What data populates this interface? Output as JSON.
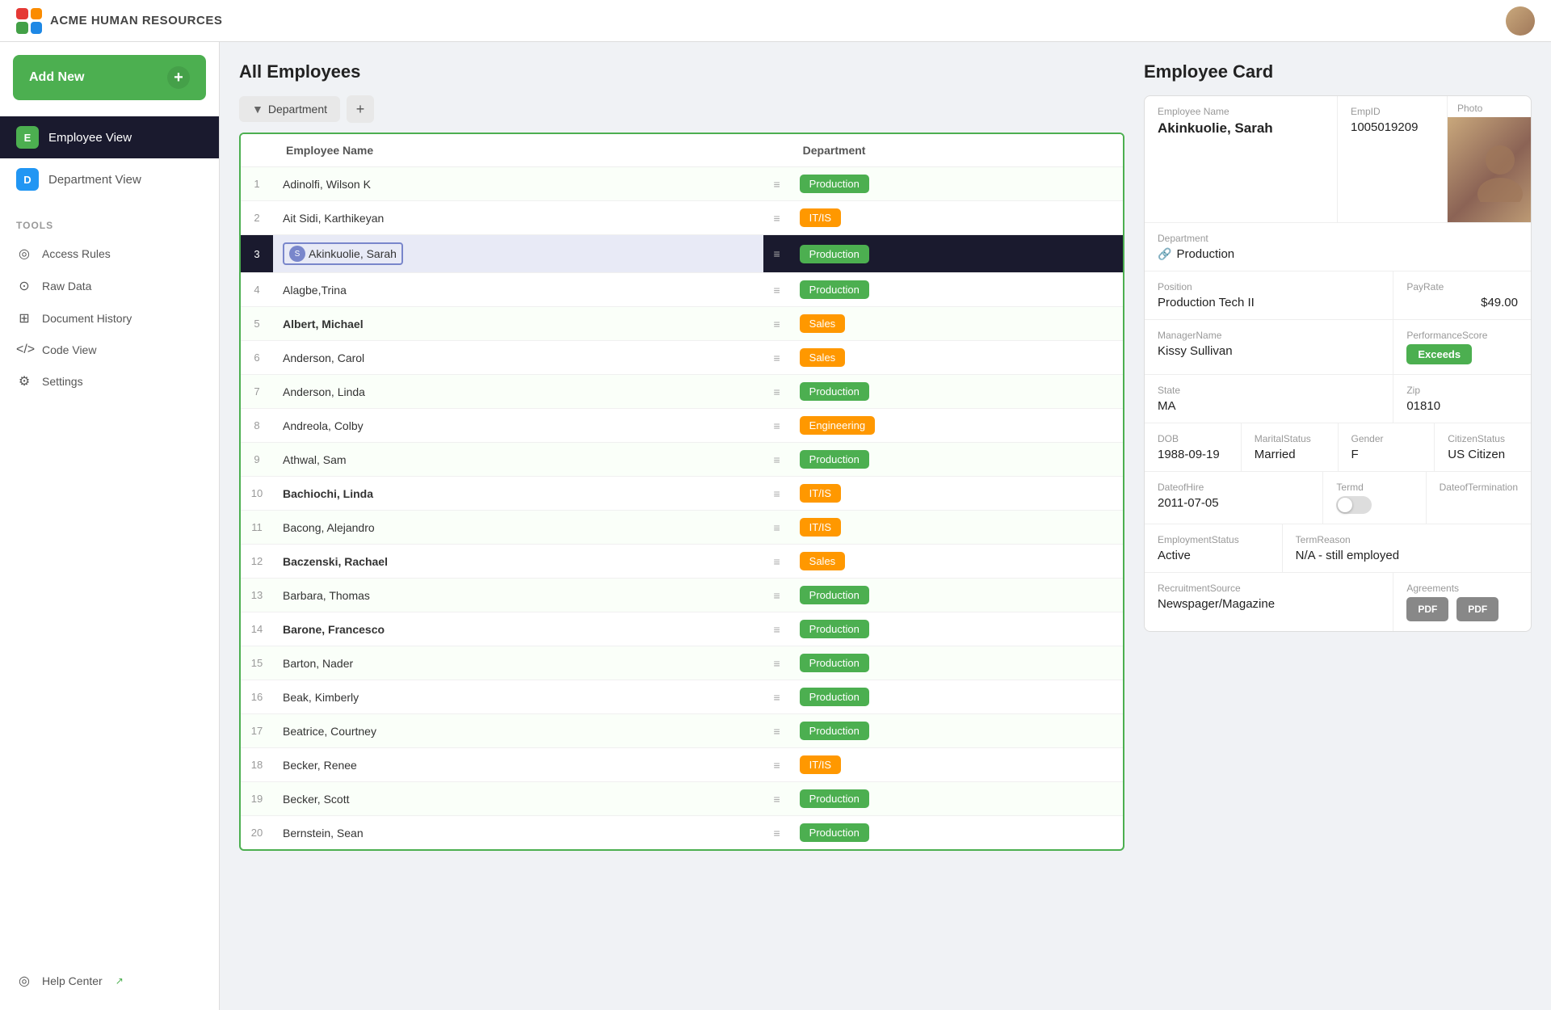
{
  "app": {
    "title": "ACME Human Resources"
  },
  "sidebar": {
    "add_new_label": "Add New",
    "nav_items": [
      {
        "id": "employee-view",
        "label": "Employee View",
        "icon": "E",
        "active": true
      },
      {
        "id": "department-view",
        "label": "Department View",
        "icon": "D",
        "active": false
      }
    ],
    "tools_label": "TOOLS",
    "tool_items": [
      {
        "id": "access-rules",
        "label": "Access Rules",
        "icon": "◎"
      },
      {
        "id": "raw-data",
        "label": "Raw Data",
        "icon": "⊙"
      },
      {
        "id": "document-history",
        "label": "Document History",
        "icon": "⊞"
      },
      {
        "id": "code-view",
        "label": "Code View",
        "icon": "</>"
      },
      {
        "id": "settings",
        "label": "Settings",
        "icon": "⚙"
      }
    ],
    "help_label": "Help Center"
  },
  "employees_section": {
    "title": "All Employees",
    "filter_label": "Department",
    "columns": {
      "num": "#",
      "name": "Employee Name",
      "department": "Department"
    },
    "rows": [
      {
        "num": 1,
        "name": "Adinolfi, Wilson  K",
        "dept": "Production",
        "dept_class": "dept-production",
        "bold": false
      },
      {
        "num": 2,
        "name": "Ait Sidi, Karthikeyan",
        "dept": "IT/IS",
        "dept_class": "dept-itis",
        "bold": false
      },
      {
        "num": 3,
        "name": "Akinkuolie, Sarah",
        "dept": "Production",
        "dept_class": "dept-production",
        "bold": false,
        "selected": true
      },
      {
        "num": 4,
        "name": "Alagbe,Trina",
        "dept": "Production",
        "dept_class": "dept-production",
        "bold": false
      },
      {
        "num": 5,
        "name": "Albert, Michael",
        "dept": "Sales",
        "dept_class": "dept-sales",
        "bold": true
      },
      {
        "num": 6,
        "name": "Anderson, Carol",
        "dept": "Sales",
        "dept_class": "dept-sales",
        "bold": false
      },
      {
        "num": 7,
        "name": "Anderson, Linda",
        "dept": "Production",
        "dept_class": "dept-production",
        "bold": false
      },
      {
        "num": 8,
        "name": "Andreola, Colby",
        "dept": "Engineering",
        "dept_class": "dept-engineering",
        "bold": false
      },
      {
        "num": 9,
        "name": "Athwal, Sam",
        "dept": "Production",
        "dept_class": "dept-production",
        "bold": false
      },
      {
        "num": 10,
        "name": "Bachiochi, Linda",
        "dept": "IT/IS",
        "dept_class": "dept-itis",
        "bold": true
      },
      {
        "num": 11,
        "name": "Bacong, Alejandro",
        "dept": "IT/IS",
        "dept_class": "dept-itis",
        "bold": false
      },
      {
        "num": 12,
        "name": "Baczenski, Rachael",
        "dept": "Sales",
        "dept_class": "dept-sales",
        "bold": true
      },
      {
        "num": 13,
        "name": "Barbara, Thomas",
        "dept": "Production",
        "dept_class": "dept-production",
        "bold": false
      },
      {
        "num": 14,
        "name": "Barone, Francesco",
        "dept": "Production",
        "dept_class": "dept-production",
        "bold": true
      },
      {
        "num": 15,
        "name": "Barton, Nader",
        "dept": "Production",
        "dept_class": "dept-production",
        "bold": false
      },
      {
        "num": 16,
        "name": "Beak, Kimberly",
        "dept": "Production",
        "dept_class": "dept-production",
        "bold": false
      },
      {
        "num": 17,
        "name": "Beatrice, Courtney",
        "dept": "Production",
        "dept_class": "dept-production",
        "bold": false
      },
      {
        "num": 18,
        "name": "Becker, Renee",
        "dept": "IT/IS",
        "dept_class": "dept-itis",
        "bold": false
      },
      {
        "num": 19,
        "name": "Becker, Scott",
        "dept": "Production",
        "dept_class": "dept-production",
        "bold": false
      },
      {
        "num": 20,
        "name": "Bernstein, Sean",
        "dept": "Production",
        "dept_class": "dept-production",
        "bold": false
      }
    ]
  },
  "employee_card": {
    "title": "Employee Card",
    "fields": {
      "employee_name_label": "Employee Name",
      "employee_name": "Akinkuolie, Sarah",
      "emp_id_label": "EmpID",
      "emp_id": "1005019209",
      "photo_label": "Photo",
      "department_label": "Department",
      "department": "Production",
      "position_label": "Position",
      "position": "Production Tech II",
      "pay_rate_label": "PayRate",
      "pay_rate": "$49.00",
      "manager_label": "ManagerName",
      "manager": "Kissy Sullivan",
      "performance_label": "PerformanceScore",
      "performance": "Exceeds",
      "state_label": "State",
      "state": "MA",
      "zip_label": "Zip",
      "zip": "01810",
      "dob_label": "DOB",
      "dob": "1988-09-19",
      "marital_label": "MaritalStatus",
      "marital": "Married",
      "gender_label": "Gender",
      "gender": "F",
      "citizen_label": "CitizenStatus",
      "citizen": "US Citizen",
      "hire_label": "DateofHire",
      "hire": "2011-07-05",
      "termd_label": "Termd",
      "term_date_label": "DateofTermination",
      "emp_status_label": "EmploymentStatus",
      "emp_status": "Active",
      "term_reason_label": "TermReason",
      "term_reason": "N/A - still employed",
      "recruit_label": "RecruitmentSource",
      "recruit": "Newspager/Magazine",
      "agreements_label": "Agreements",
      "pdf1": "PDF",
      "pdf2": "PDF"
    }
  }
}
